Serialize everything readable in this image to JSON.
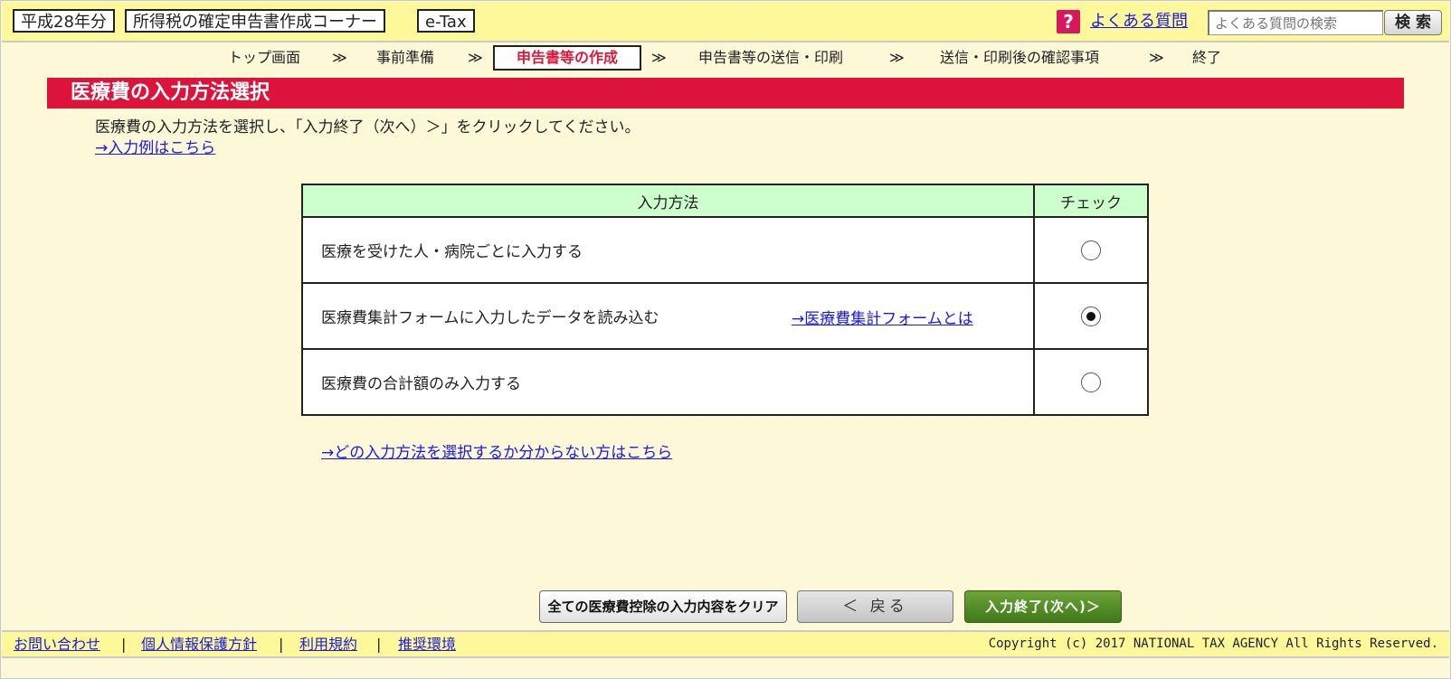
{
  "header": {
    "year": "平成28年分",
    "corner": "所得税の確定申告書作成コーナー",
    "etax": "e-Tax",
    "help_icon": "?",
    "faq_label": "よくある質問",
    "search_placeholder": "よくある質問の検索",
    "search_button": "検 索"
  },
  "steps": {
    "items": [
      "トップ画面",
      "事前準備",
      "申告書等の作成",
      "申告書等の送信・印刷",
      "送信・印刷後の確認事項",
      "終了"
    ],
    "separator": "≫",
    "current_index": 2
  },
  "page": {
    "title": "医療費の入力方法選択",
    "instruction": "医療費の入力方法を選択し、「入力終了（次へ）＞」をクリックしてください。",
    "example_link": "→入力例はこちら"
  },
  "table": {
    "headers": [
      "入力方法",
      "チェック"
    ],
    "rows": [
      {
        "label": "医療を受けた人・病院ごとに入力する",
        "link": "",
        "checked": false
      },
      {
        "label": "医療費集計フォームに入力したデータを読み込む",
        "link": "→医療費集計フォームとは",
        "checked": true
      },
      {
        "label": "医療費の合計額のみ入力する",
        "link": "",
        "checked": false
      }
    ]
  },
  "help_link": "→どの入力方法を選択するか分からない方はこちら",
  "buttons": {
    "clear": "全ての医療費控除の入力内容をクリア",
    "back": "＜ 戻る",
    "next": "入力終了(次へ)＞"
  },
  "footer": {
    "links": [
      "お問い合わせ",
      "個人情報保護方針",
      "利用規約",
      "推奨環境"
    ],
    "separator": "|",
    "copyright": "Copyright (c) 2017 NATIONAL TAX AGENCY All Rights Reserved."
  },
  "colors": {
    "header_bg": "#fdf99a",
    "page_bg": "#fdf9d8",
    "title_bar": "#dc143c",
    "table_header": "#ccffcc",
    "link": "#1a1ae0",
    "next_button": "#4f8a22"
  }
}
